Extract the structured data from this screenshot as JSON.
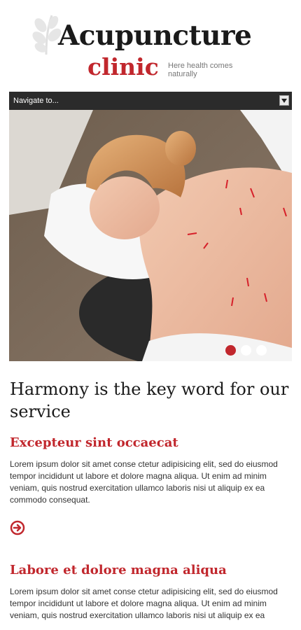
{
  "logo": {
    "title": "Acupuncture",
    "subtitle": "clinic",
    "tagline": "Here health comes naturally"
  },
  "nav": {
    "label": "Navigate to..."
  },
  "slider": {
    "slide_count": 3,
    "active_index": 0
  },
  "main": {
    "headline": "Harmony is the key word for our service",
    "sections": [
      {
        "title": "Excepteur sint occaecat",
        "body": "Lorem ipsum dolor sit amet conse ctetur adipisicing elit, sed do eiusmod tempor incididunt ut labore et dolore magna aliqua. Ut enim ad minim veniam, quis nostrud exercitation ullamco laboris nisi ut aliquip ex ea commodo consequat.",
        "icon": "arrow-right-circle-icon"
      },
      {
        "title": "Labore et dolore magna aliqua",
        "body": "Lorem ipsum dolor sit amet conse ctetur adipisicing elit, sed do eiusmod tempor incididunt ut labore et dolore magna aliqua. Ut enim ad minim veniam, quis nostrud exercitation ullamco laboris nisi ut aliquip ex ea"
      }
    ]
  },
  "colors": {
    "accent": "#c1272d",
    "nav_bg": "#2b2b2b",
    "text": "#333333"
  }
}
